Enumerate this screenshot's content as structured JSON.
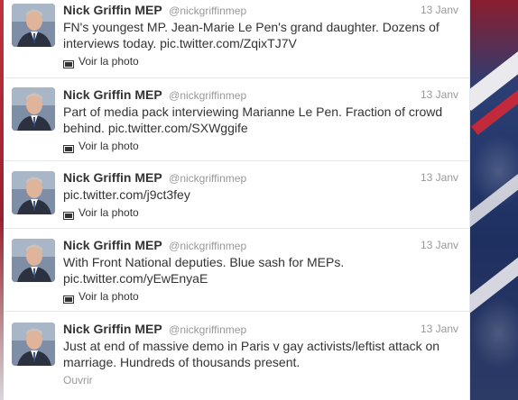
{
  "colors": {
    "name_text": "#333333",
    "secondary_text": "#999999",
    "timeline_bg": "#ffffff",
    "divider": "#e8e8e8"
  },
  "tweets": [
    {
      "fullname": "Nick Griffin MEP",
      "username": "@nickgriffinmep",
      "time": "13 Janv",
      "text_before": "FN's youngest MP. Jean-Marie Le Pen's grand daughter. Dozens of interviews today. ",
      "link": "pic.twitter.com/ZqixTJ7V",
      "action_label": "Voir la photo",
      "action_icon": "photo-icon"
    },
    {
      "fullname": "Nick Griffin MEP",
      "username": "@nickgriffinmep",
      "time": "13 Janv",
      "text_before": "Part of media pack interviewing Marianne Le Pen. Fraction of crowd behind. ",
      "link": "pic.twitter.com/SXWggife",
      "action_label": "Voir la photo",
      "action_icon": "photo-icon"
    },
    {
      "fullname": "Nick Griffin MEP",
      "username": "@nickgriffinmep",
      "time": "13 Janv",
      "text_before": "",
      "link": "pic.twitter.com/j9ct3fey",
      "action_label": "Voir la photo",
      "action_icon": "photo-icon"
    },
    {
      "fullname": "Nick Griffin MEP",
      "username": "@nickgriffinmep",
      "time": "13 Janv",
      "text_before": "With Front National deputies. Blue sash for MEPs. ",
      "link": "pic.twitter.com/yEwEnyaE",
      "action_label": "Voir la photo",
      "action_icon": "photo-icon"
    },
    {
      "fullname": "Nick Griffin MEP",
      "username": "@nickgriffinmep",
      "time": "13 Janv",
      "text_before": "Just at end of massive demo in Paris v gay activists/leftist attack on marriage. Hundreds of thousands present.",
      "link": "",
      "action_label": "Ouvrir",
      "action_icon": ""
    }
  ]
}
